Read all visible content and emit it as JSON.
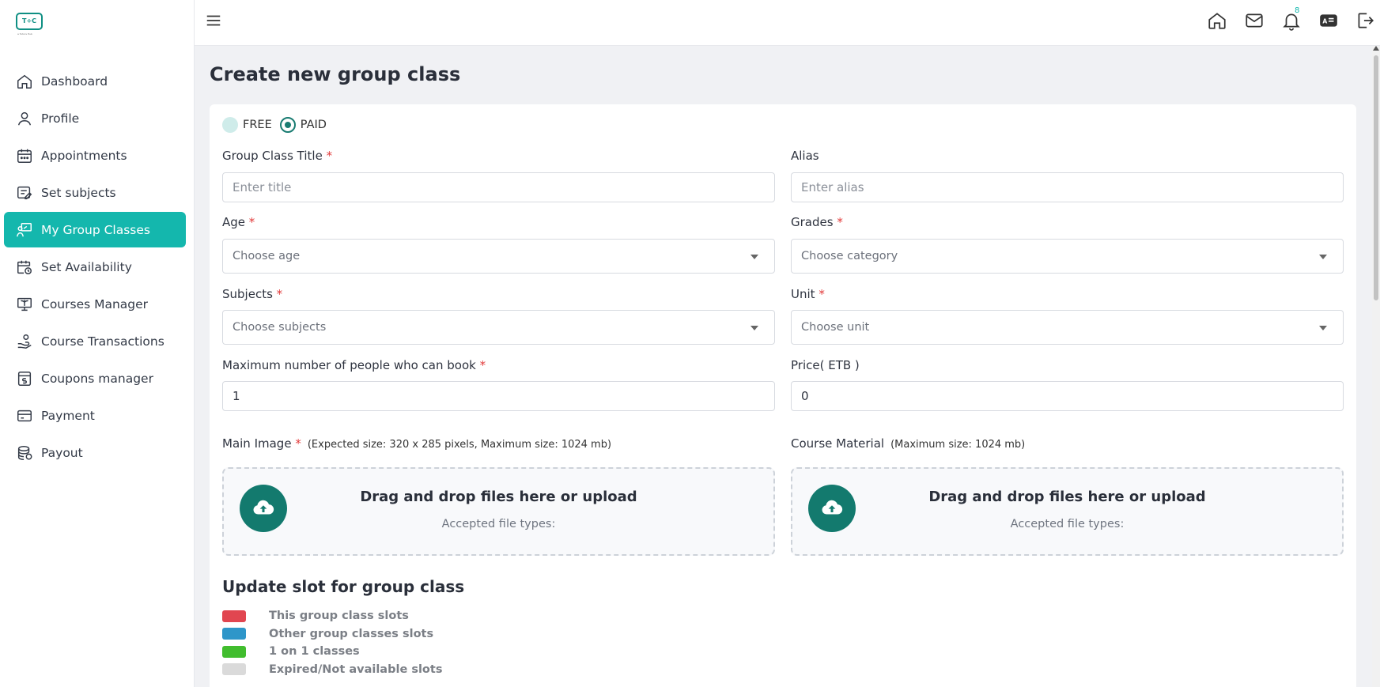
{
  "brand": {
    "logo_text": "T÷C",
    "logo_sub": "a Tutors Hub"
  },
  "sidebar": {
    "items": [
      {
        "label": "Dashboard",
        "icon": "home-icon",
        "active": false
      },
      {
        "label": "Profile",
        "icon": "user-icon",
        "active": false
      },
      {
        "label": "Appointments",
        "icon": "calendar-icon",
        "active": false
      },
      {
        "label": "Set subjects",
        "icon": "subjects-icon",
        "active": false
      },
      {
        "label": "My Group Classes",
        "icon": "group-class-icon",
        "active": true
      },
      {
        "label": "Set Availability",
        "icon": "calendar-clock-icon",
        "active": false
      },
      {
        "label": "Courses Manager",
        "icon": "courses-icon",
        "active": false
      },
      {
        "label": "Course Transactions",
        "icon": "hand-coin-icon",
        "active": false
      },
      {
        "label": "Coupons manager",
        "icon": "coupon-icon",
        "active": false
      },
      {
        "label": "Payment",
        "icon": "card-icon",
        "active": false
      },
      {
        "label": "Payout",
        "icon": "coins-icon",
        "active": false
      }
    ]
  },
  "header": {
    "notifications_count": "8",
    "icons": [
      "home-icon",
      "mail-icon",
      "bell-icon",
      "id-card-icon",
      "logout-icon"
    ]
  },
  "page": {
    "title": "Create new group class",
    "pricing": {
      "free_label": "FREE",
      "paid_label": "PAID",
      "selected": "PAID"
    },
    "fields": {
      "title": {
        "label": "Group Class Title",
        "placeholder": "Enter title",
        "value": ""
      },
      "alias": {
        "label": "Alias",
        "placeholder": "Enter alias",
        "value": ""
      },
      "age": {
        "label": "Age",
        "placeholder": "Choose age"
      },
      "grades": {
        "label": "Grades",
        "placeholder": "Choose category"
      },
      "subjects": {
        "label": "Subjects",
        "placeholder": "Choose subjects"
      },
      "unit": {
        "label": "Unit",
        "placeholder": "Choose unit"
      },
      "max_people": {
        "label": "Maximum number of people who can book",
        "value": "1"
      },
      "price": {
        "label": "Price( ETB )",
        "value": "0"
      }
    },
    "uploads": {
      "main_image": {
        "label": "Main Image",
        "hint": "(Expected size: 320 x 285 pixels, Maximum size: 1024 mb)",
        "title": "Drag and drop files here or upload",
        "sub": "Accepted file types:"
      },
      "course_material": {
        "label": "Course Material",
        "hint": "(Maximum size: 1024 mb)",
        "title": "Drag and drop files here or upload",
        "sub": "Accepted file types:"
      }
    },
    "slots": {
      "title": "Update slot for group class",
      "legend": [
        {
          "label": "This group class slots",
          "color": "#e14650"
        },
        {
          "label": "Other group classes slots",
          "color": "#2e96c9"
        },
        {
          "label": "1 on 1 classes",
          "color": "#41bd2e"
        },
        {
          "label": "Expired/Not available slots",
          "color": "#dadada"
        }
      ]
    }
  },
  "colors": {
    "accent": "#14b7ad",
    "dark_accent": "#137a6e",
    "required": "#e23b3b"
  }
}
